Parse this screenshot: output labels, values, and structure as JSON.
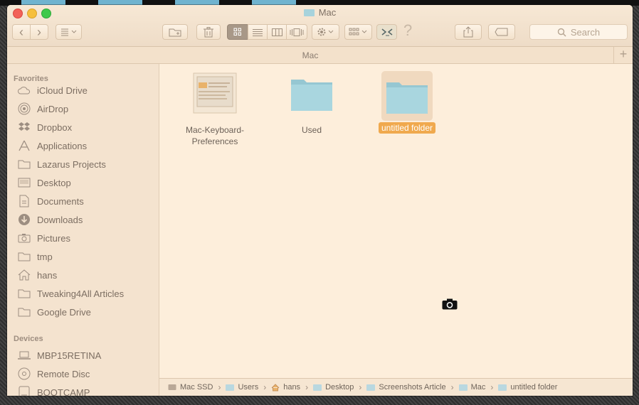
{
  "window": {
    "title": "Mac"
  },
  "toolbar": {
    "back": "‹",
    "forward": "›",
    "help": "?",
    "search_placeholder": "Search"
  },
  "path_header": {
    "label": "Mac",
    "add": "+"
  },
  "sidebar": {
    "favorites_label": "Favorites",
    "favorites": [
      {
        "label": "iCloud Drive",
        "icon": "cloud-icon"
      },
      {
        "label": "AirDrop",
        "icon": "airdrop-icon"
      },
      {
        "label": "Dropbox",
        "icon": "dropbox-icon"
      },
      {
        "label": "Applications",
        "icon": "applications-icon"
      },
      {
        "label": "Lazarus Projects",
        "icon": "folder-icon"
      },
      {
        "label": "Desktop",
        "icon": "desktop-icon"
      },
      {
        "label": "Documents",
        "icon": "documents-icon"
      },
      {
        "label": "Downloads",
        "icon": "downloads-icon"
      },
      {
        "label": "Pictures",
        "icon": "camera-icon"
      },
      {
        "label": "tmp",
        "icon": "folder-icon"
      },
      {
        "label": "hans",
        "icon": "home-icon"
      },
      {
        "label": "Tweaking4All Articles",
        "icon": "folder-icon"
      },
      {
        "label": "Google Drive",
        "icon": "folder-icon"
      }
    ],
    "devices_label": "Devices",
    "devices": [
      {
        "label": "MBP15RETINA",
        "icon": "laptop-icon"
      },
      {
        "label": "Remote Disc",
        "icon": "disc-icon"
      },
      {
        "label": "BOOTCAMP",
        "icon": "drive-icon"
      }
    ]
  },
  "files": [
    {
      "name_line1": "Mac-Keyboard-",
      "name_line2": "Preferences",
      "kind": "image"
    },
    {
      "name_line1": "Used",
      "name_line2": "",
      "kind": "folder"
    },
    {
      "name_line1": "untitled folder",
      "name_line2": "",
      "kind": "folder",
      "selected": true
    }
  ],
  "pathbar": [
    "Mac SSD",
    "Users",
    "hans",
    "Desktop",
    "Screenshots Article",
    "Mac",
    "untitled folder"
  ],
  "colors": {
    "selection": "#f0a94e",
    "folder": "#a7d3dc"
  }
}
